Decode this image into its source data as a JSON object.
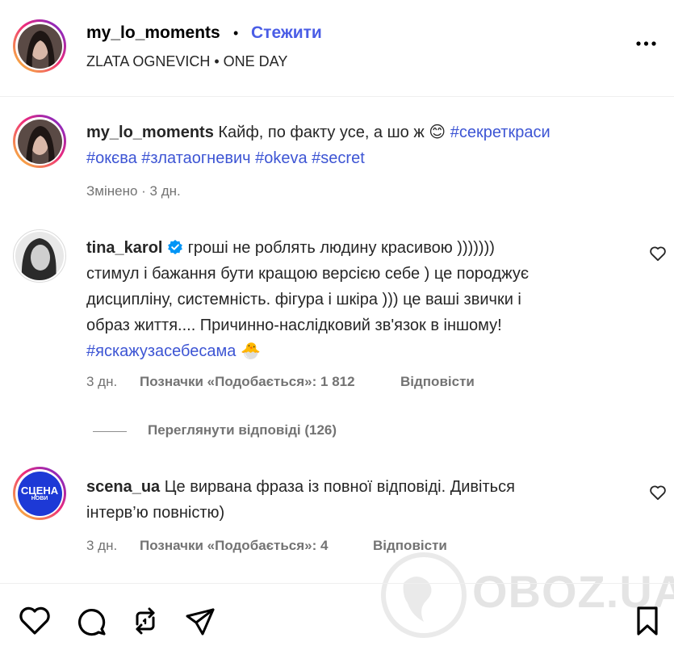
{
  "header": {
    "username": "my_lo_moments",
    "separator": "•",
    "follow_label": "Стежити",
    "subtitle": "ZLATA OGNEVICH • ONE DAY",
    "more_label": "..."
  },
  "caption": {
    "username": "my_lo_moments",
    "text": "Кайф, по факту усе, а шо ж",
    "emoji": "😊",
    "hashtags_line1": "#секреткраси",
    "hashtags_line2": "#окєва #златаогневич #okeva #secret",
    "meta": "Змінено · 3 дн."
  },
  "comments": [
    {
      "username": "tina_karol",
      "verified": true,
      "lines": [
        "гроші не роблять людину красивою )))))))",
        "стимул і бажання бути кращою версією себе ) це породжує",
        "дисципліну, системність. фігура і шкіра ))) це ваші звички і",
        "образ життя.... Причинно-наслідковий зв'язок в іншому!"
      ],
      "hashtag": "#яскажузасебесама",
      "emoji": "🐣",
      "time": "3 дн.",
      "likes": "Позначки «Подобається»: 1 812",
      "reply": "Відповісти",
      "view_replies": "Переглянути відповіді (126)"
    },
    {
      "username": "scena_ua",
      "line1": "Це вирвана фраза із повної відповіді. Дивіться",
      "line2": "інтерв’ю повністю)",
      "time": "3 дн.",
      "likes": "Позначки «Подобається»: 4",
      "reply": "Відповісти",
      "avatar_text_1": "СЦЕНА",
      "avatar_text_2": "НОВИ"
    }
  ],
  "watermark": "OBOZ.UA",
  "actions": [
    "heart-icon",
    "comment-icon",
    "repost-icon",
    "share-icon",
    "bookmark-icon"
  ]
}
